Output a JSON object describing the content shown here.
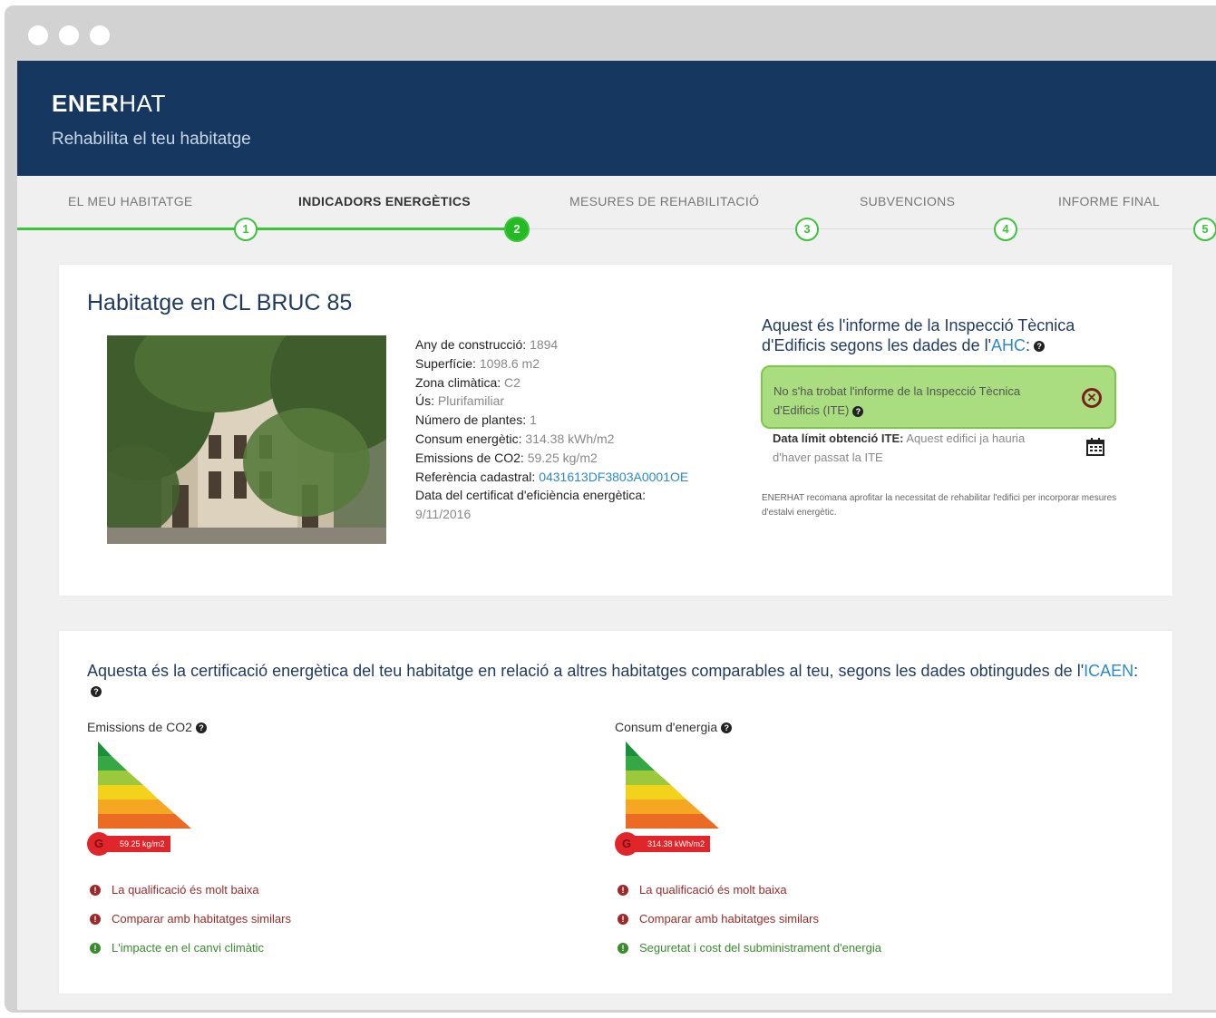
{
  "app": {
    "brand_bold": "ENER",
    "brand_light": "HAT",
    "tagline": "Rehabilita el teu habitatge"
  },
  "steps": [
    {
      "label": "EL MEU HABITATGE",
      "number": "1"
    },
    {
      "label": "INDICADORS ENERGÈTICS",
      "number": "2"
    },
    {
      "label": "MESURES DE REHABILITACIÓ",
      "number": "3"
    },
    {
      "label": "SUBVENCIONS",
      "number": "4"
    },
    {
      "label": "INFORME FINAL",
      "number": "5"
    }
  ],
  "house": {
    "title": "Habitatge en CL BRUC 85",
    "props": [
      {
        "key": "Any de construcció:",
        "value": "1894"
      },
      {
        "key": "Superfície:",
        "value": "1098.6 m2"
      },
      {
        "key": "Zona climàtica:",
        "value": "C2"
      },
      {
        "key": "Ús:",
        "value": "Plurifamiliar"
      },
      {
        "key": "Número de plantes:",
        "value": "1"
      },
      {
        "key": "Consum energètic:",
        "value": "314.38 kWh/m2"
      },
      {
        "key": "Emissions de CO2:",
        "value": "59.25 kg/m2"
      },
      {
        "key": "Referència cadastral:",
        "value": "0431613DF3803A0001OE"
      },
      {
        "key": "Data del certificat d'eficiència energètica:",
        "value": "9/11/2016"
      }
    ]
  },
  "ite": {
    "title_prefix": "Aquest és l'informe de la Inspecció Tècnica d'Edificis segons les dades de l'",
    "title_link": "AHC",
    "title_suffix": ":",
    "alert": "No s'ha trobat l'informe de la Inspecció Tècnica d'Edificis (ITE)",
    "deadline_key": "Data límit obtenció ITE:",
    "deadline_value": "Aquest edifici ja hauria d'haver passat la ITE",
    "recommend": "ENERHAT recomana aprofitar la necessitat de rehabilitar l'edifici per incorporar mesures d'estalvi energètic."
  },
  "cert": {
    "title_prefix": "Aquesta és la certificació energètica del teu habitatge en relació a altres habitatges comparables al teu, segons les dades obtingudes de l'",
    "title_link": "ICAEN",
    "title_suffix": ":",
    "emissions": {
      "label": "Emissions de CO2",
      "grade": "G",
      "value": "59.25 kg/m2",
      "messages": [
        {
          "text": "La qualificació és molt baixa",
          "type": "bad"
        },
        {
          "text": "Comparar amb habitatges similars",
          "type": "bad"
        },
        {
          "text": "L'impacte en el canvi climàtic",
          "type": "good"
        }
      ]
    },
    "energy": {
      "label": "Consum d'energia",
      "grade": "G",
      "value": "314.38 kWh/m2",
      "messages": [
        {
          "text": "La qualificació és molt baixa",
          "type": "bad"
        },
        {
          "text": "Comparar amb habitatges similars",
          "type": "bad"
        },
        {
          "text": "Seguretat i cost del subministrament d'energia",
          "type": "good"
        }
      ]
    }
  },
  "colors": {
    "header": "#16375f",
    "progress": "#3cc43c",
    "alert_bg": "#a9dd7f",
    "grade_bar": [
      "#1a8f3c",
      "#35a844",
      "#9cc93b",
      "#f2d21a",
      "#f5a623",
      "#ec6b24",
      "#e0262a"
    ]
  }
}
